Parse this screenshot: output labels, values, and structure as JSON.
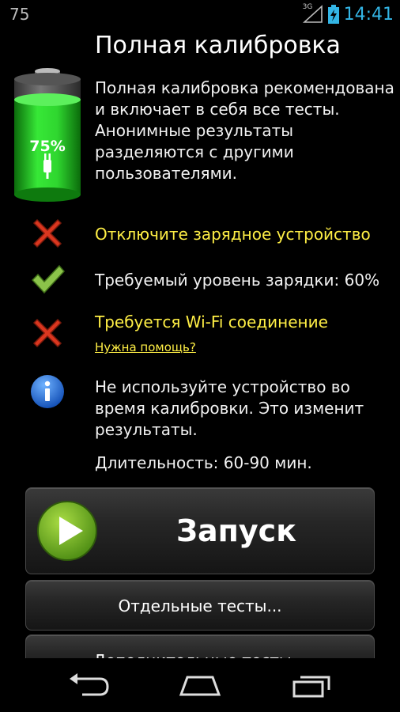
{
  "status_bar": {
    "notification": "75",
    "network": "3G",
    "time": "14:41"
  },
  "title": "Полная калибровка",
  "battery": {
    "percent_label": "75%",
    "level": 0.75
  },
  "description": [
    "Полная калибровка рекомендована",
    "и включает в себя все тесты.",
    "Анонимные результаты",
    "разделяются с другими",
    "пользователями."
  ],
  "checks": [
    {
      "icon": "red-cross-icon",
      "text": "Отключите зарядное устройство",
      "color": "#ffef45"
    },
    {
      "icon": "green-check-icon",
      "text": "Требуемый уровень зарядки: 60%",
      "color": "#f2f2f2"
    },
    {
      "icon": "red-cross-icon",
      "text": "Требуется Wi-Fi соединение",
      "color": "#ffef45"
    }
  ],
  "help_link": "Нужна помощь?",
  "info": [
    "Не используйте устройство во",
    "время калибровки. Это изменит",
    "результаты."
  ],
  "duration": "Длительность: 60-90 мин.",
  "buttons": {
    "start": "Запуск",
    "tests": "Отдельные тесты...",
    "more": "Дополнительные тесты..."
  },
  "colors": {
    "accent": "#33b5e5",
    "warning": "#ffef45",
    "battery_green": "#2fd62f"
  }
}
